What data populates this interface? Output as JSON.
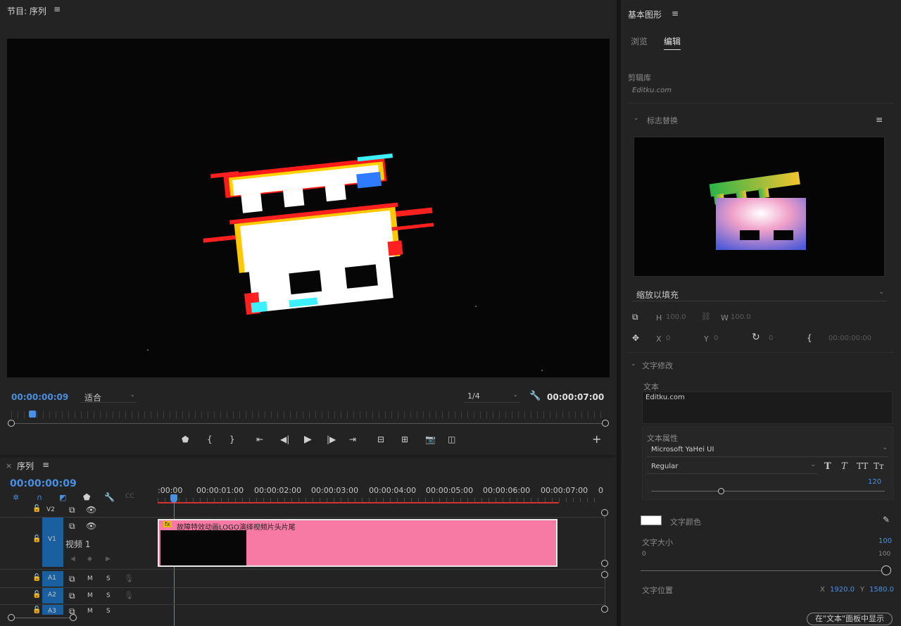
{
  "program": {
    "title": "节目: 序列",
    "menu_icon": "≡",
    "timecode_current": "00:00:00:09",
    "fit_select": "适合",
    "resolution_select": "1/4",
    "timecode_total": "00:00:07:00"
  },
  "transport": {
    "icons": [
      "marker-icon",
      "mark-in-icon",
      "mark-out-icon",
      "go-to-in-icon",
      "step-back-icon",
      "play-icon",
      "step-forward-icon",
      "go-to-out-icon",
      "insert-icon",
      "overwrite-icon",
      "export-frame-icon",
      "compare-icon",
      "add-button-icon"
    ]
  },
  "sequence": {
    "close": "×",
    "title": "序列",
    "menu_icon": "≡",
    "timecode": "00:00:00:09",
    "ruler_ticks": [
      ":00:00",
      "00:00:01:00",
      "00:00:02:00",
      "00:00:03:00",
      "00:00:04:00",
      "00:00:05:00",
      "00:00:06:00",
      "00:00:07:00",
      "0"
    ],
    "tracks": {
      "v2": "V2",
      "v1": "V1",
      "v1_name": "视频 1",
      "a1": "A1",
      "a2": "A2",
      "a3": "A3",
      "m": "M",
      "s": "S"
    },
    "clip_label": "故障特效动画LOGO演绎视频片头片尾",
    "clip_fx": "fx"
  },
  "graphics": {
    "title": "基本图形",
    "menu_icon": "≡",
    "tabs": [
      "浏览",
      "编辑"
    ],
    "active_tab": "编辑",
    "library_label": "剪辑库",
    "library_value": "Editku.com",
    "section_logo": "标志替换",
    "scale_select": "缩放以填充",
    "h_label": "H",
    "h_value": "100.0",
    "w_label": "W",
    "w_value": "100.0",
    "x_label": "X",
    "x_value": "0",
    "y_label": "Y",
    "y_value": "0",
    "rot_value": "0",
    "time_value": "00:00:00:00",
    "section_text": "文字修改",
    "text_label": "文本",
    "text_value": "Editku.com",
    "text_props_label": "文本属性",
    "font_family": "Microsoft YaHei UI",
    "font_style": "Regular",
    "font_size_value": "120",
    "color_label": "文字颜色",
    "size_label": "文字大小",
    "size_value": "100",
    "size_min": "0",
    "size_max": "100",
    "pos_label": "文字位置",
    "pos_x_label": "X",
    "pos_x_value": "1920.0",
    "pos_y_label": "Y",
    "pos_y_value": "1580.0",
    "show_in_text_panel": "在\"文本\"面板中显示"
  },
  "colors": {
    "accent": "#4a90e2",
    "clip": "#f77aa5",
    "track_blue": "#1a5fa0"
  }
}
